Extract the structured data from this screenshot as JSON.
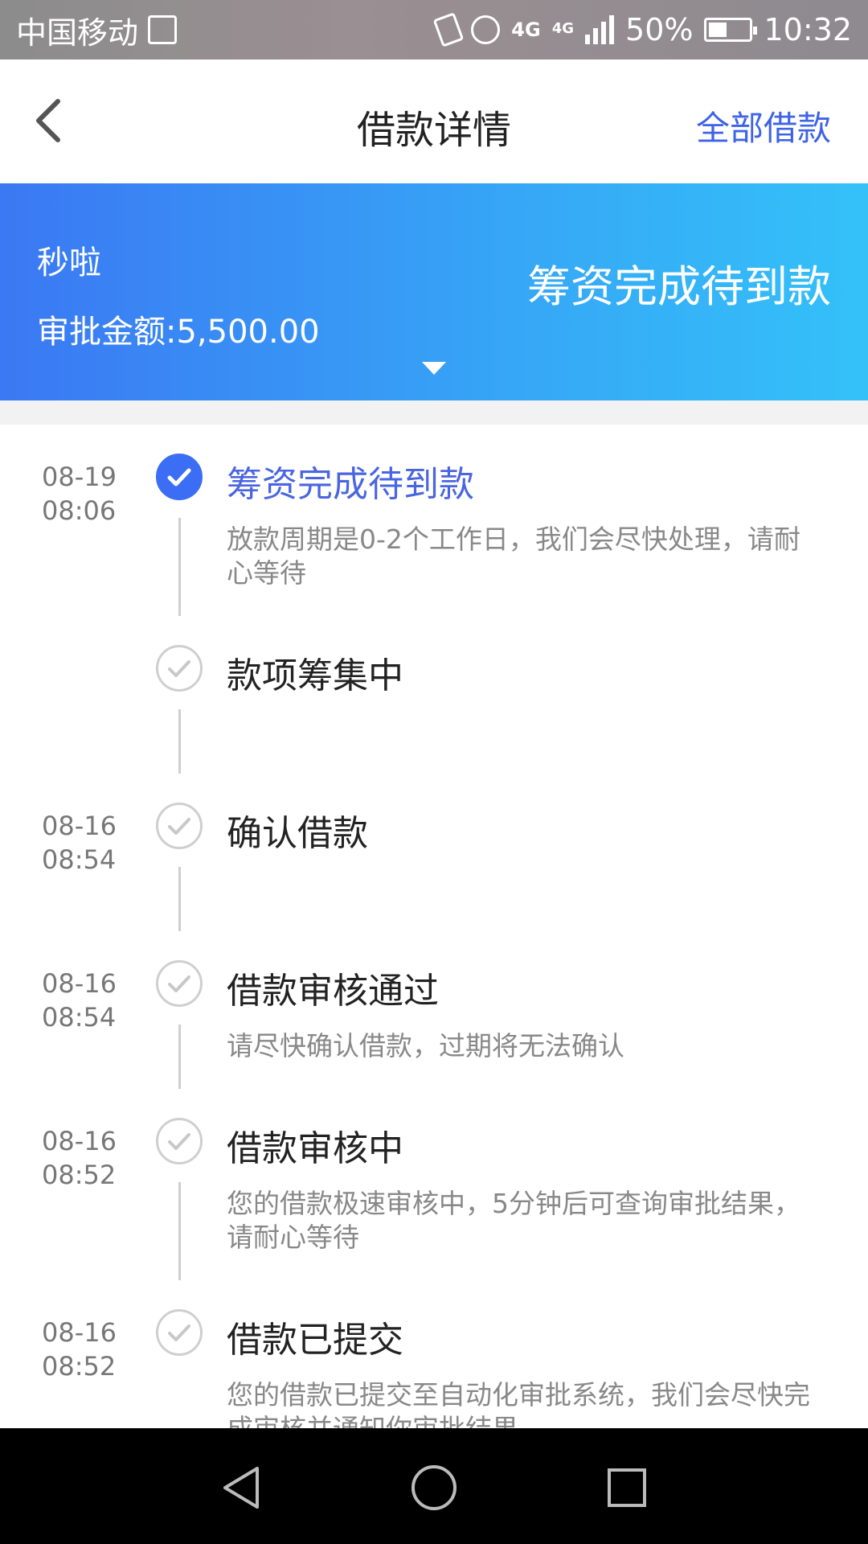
{
  "status_bar": {
    "carrier": "中国移动",
    "network1": "4G",
    "network2": "4G",
    "battery": "50%",
    "time": "10:32"
  },
  "header": {
    "title": "借款详情",
    "right_link": "全部借款"
  },
  "banner": {
    "product": "秒啦",
    "amount_label": "审批金额:5,500.00",
    "status": "筹资完成待到款"
  },
  "timeline": [
    {
      "date": "08-19",
      "time": "08:06",
      "title": "筹资完成待到款",
      "desc": "放款周期是0-2个工作日，我们会尽快处理，请耐心等待",
      "active": true
    },
    {
      "date": "",
      "time": "",
      "title": "款项筹集中",
      "desc": "",
      "active": false
    },
    {
      "date": "08-16",
      "time": "08:54",
      "title": "确认借款",
      "desc": "",
      "active": false
    },
    {
      "date": "08-16",
      "time": "08:54",
      "title": "借款审核通过",
      "desc": "请尽快确认借款，过期将无法确认",
      "active": false
    },
    {
      "date": "08-16",
      "time": "08:52",
      "title": "借款审核中",
      "desc": "您的借款极速审核中，5分钟后可查询审批结果，请耐心等待",
      "active": false
    },
    {
      "date": "08-16",
      "time": "08:52",
      "title": "借款已提交",
      "desc": "您的借款已提交至自动化审批系统，我们会尽快完成审核并通知你审批结果",
      "active": false
    }
  ],
  "colors": {
    "accent": "#3f63e6",
    "banner_start": "#3b78f3",
    "banner_end": "#34c1f8"
  }
}
